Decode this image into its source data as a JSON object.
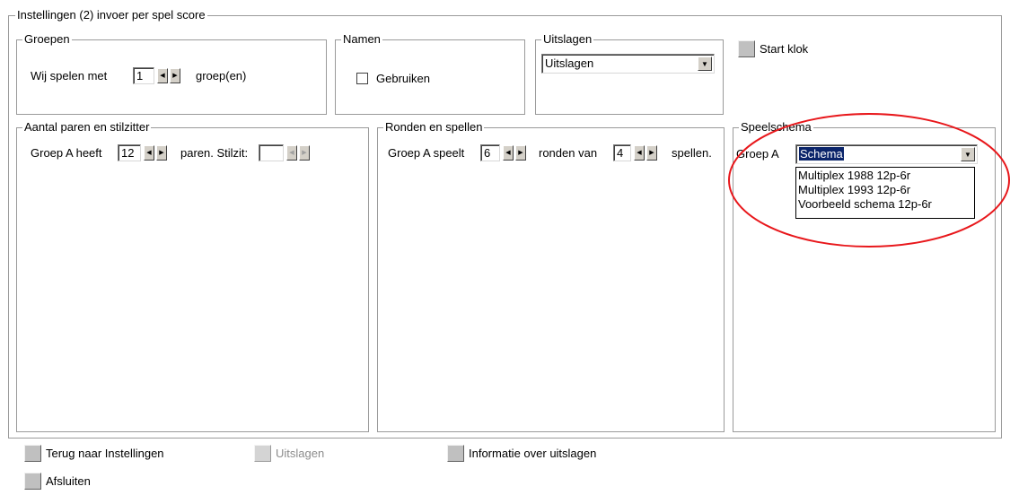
{
  "main_group": {
    "title": "Instellingen (2)  invoer per spel score"
  },
  "groepen": {
    "title": "Groepen",
    "prefix": "Wij spelen met",
    "value": "1",
    "suffix": "groep(en)"
  },
  "namen": {
    "title": "Namen",
    "checkbox_label": "Gebruiken"
  },
  "uitslagen_group": {
    "title": "Uitslagen",
    "selected": "Uitslagen"
  },
  "start_klok": {
    "label": "Start klok"
  },
  "paren": {
    "title": "Aantal paren en stilzitter",
    "prefix": "Groep A heeft",
    "value": "12",
    "middle": "paren. Stilzit:",
    "stilzit_value": ""
  },
  "ronden": {
    "title": "Ronden en spellen",
    "prefix": "Groep A speelt",
    "rounds_value": "6",
    "middle": "ronden van",
    "games_value": "4",
    "suffix": "spellen."
  },
  "speelschema": {
    "title": "Speelschema",
    "group_label": "Groep A",
    "selected": "Schema",
    "options": [
      "Multiplex 1988 12p-6r",
      "Multiplex 1993 12p-6r",
      "Voorbeeld schema 12p-6r"
    ]
  },
  "annotation": {
    "color": "#e8171b"
  },
  "bottom": {
    "terug": "Terug naar Instellingen",
    "uitslagen": "Uitslagen",
    "informatie": "Informatie over uitslagen",
    "afsluiten": "Afsluiten"
  }
}
